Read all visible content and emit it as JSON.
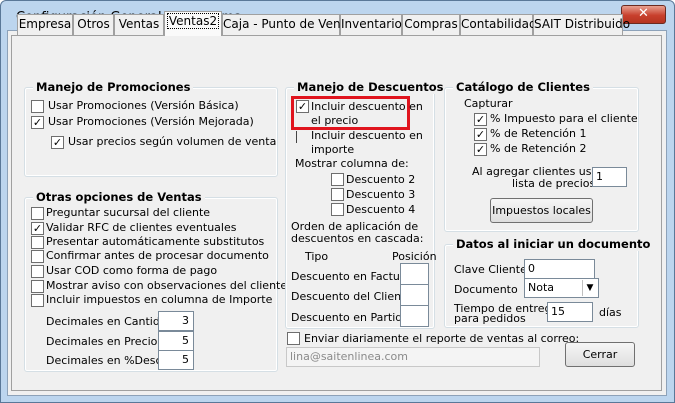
{
  "window": {
    "title": "Configuración General del Sistema",
    "close": "✕"
  },
  "tabs": [
    "Empresa",
    "Otros",
    "Ventas",
    "Ventas2",
    "Caja - Punto de Venta",
    "Inventario",
    "Compras",
    "Contabilidad",
    "SAIT Distribuido"
  ],
  "promociones": {
    "title": "Manejo de Promociones",
    "items": [
      {
        "label": "Usar Promociones (Versión Básica)",
        "checked": false
      },
      {
        "label": "Usar Promociones (Versión Mejorada)",
        "checked": true
      },
      {
        "label": "Usar precios según volumen de venta",
        "checked": true
      }
    ]
  },
  "otras": {
    "title": "Otras opciones de Ventas",
    "items": [
      {
        "label": "Preguntar sucursal del cliente",
        "checked": false
      },
      {
        "label": "Validar RFC de clientes eventuales",
        "checked": true
      },
      {
        "label": "Presentar automáticamente substitutos",
        "checked": false
      },
      {
        "label": "Confirmar antes de procesar documento",
        "checked": false
      },
      {
        "label": "Usar COD como forma de pago",
        "checked": false
      },
      {
        "label": "Mostrar aviso con observaciones del cliente",
        "checked": false
      },
      {
        "label": "Incluir impuestos en columna de Importe",
        "checked": false
      }
    ],
    "decimales": [
      {
        "label": "Decimales en Cantidad",
        "value": "3"
      },
      {
        "label": "Decimales en Precio",
        "value": "5"
      },
      {
        "label": "Decimales en %Desc",
        "value": "5"
      }
    ]
  },
  "descuentos": {
    "title": "Manejo de Descuentos",
    "incluir_precio": {
      "line1": "Incluir descuento en",
      "line2": "el precio",
      "checked": true
    },
    "incluir_importe": {
      "line1": "Incluir descuento en",
      "line2": "importe",
      "checked": false
    },
    "mostrar_label": "Mostrar columna de:",
    "columnas": [
      {
        "label": "Descuento 2",
        "checked": false
      },
      {
        "label": "Descuento 3",
        "checked": false
      },
      {
        "label": "Descuento 4",
        "checked": false
      }
    ],
    "orden_label1": "Orden de aplicación de",
    "orden_label2": "descuentos en cascada:",
    "tipo_header": "Tipo",
    "pos_header": "Posición",
    "tipos": [
      {
        "label": "Descuento en Factura",
        "value": ""
      },
      {
        "label": "Descuento del Cliente",
        "value": ""
      },
      {
        "label": "Descuento en Partida",
        "value": ""
      }
    ]
  },
  "catalogo": {
    "title": "Catálogo de Clientes",
    "capturar": "Capturar",
    "items": [
      {
        "label": "% Impuesto para el cliente",
        "checked": true
      },
      {
        "label": "% de Retención 1",
        "checked": true
      },
      {
        "label": "% de Retención 2",
        "checked": true
      }
    ],
    "agregar1": "Al agregar clientes usar",
    "agregar2": "lista de precios",
    "lista_value": "1",
    "impuestos_btn": "Impuestos locales"
  },
  "datos": {
    "title": "Datos al iniciar un documento",
    "clave_label": "Clave Cliente",
    "clave_value": "0",
    "doc_label": "Documento",
    "doc_value": "Nota",
    "tiempo1": "Tiempo de entrega",
    "tiempo2": "para pedidos",
    "tiempo_value": "15",
    "dias": "días"
  },
  "reporte": {
    "label": "Enviar diariamente el reporte de ventas al correo:",
    "checked": false,
    "email": "lina@saitenlinea.com"
  },
  "cerrar": "Cerrar"
}
